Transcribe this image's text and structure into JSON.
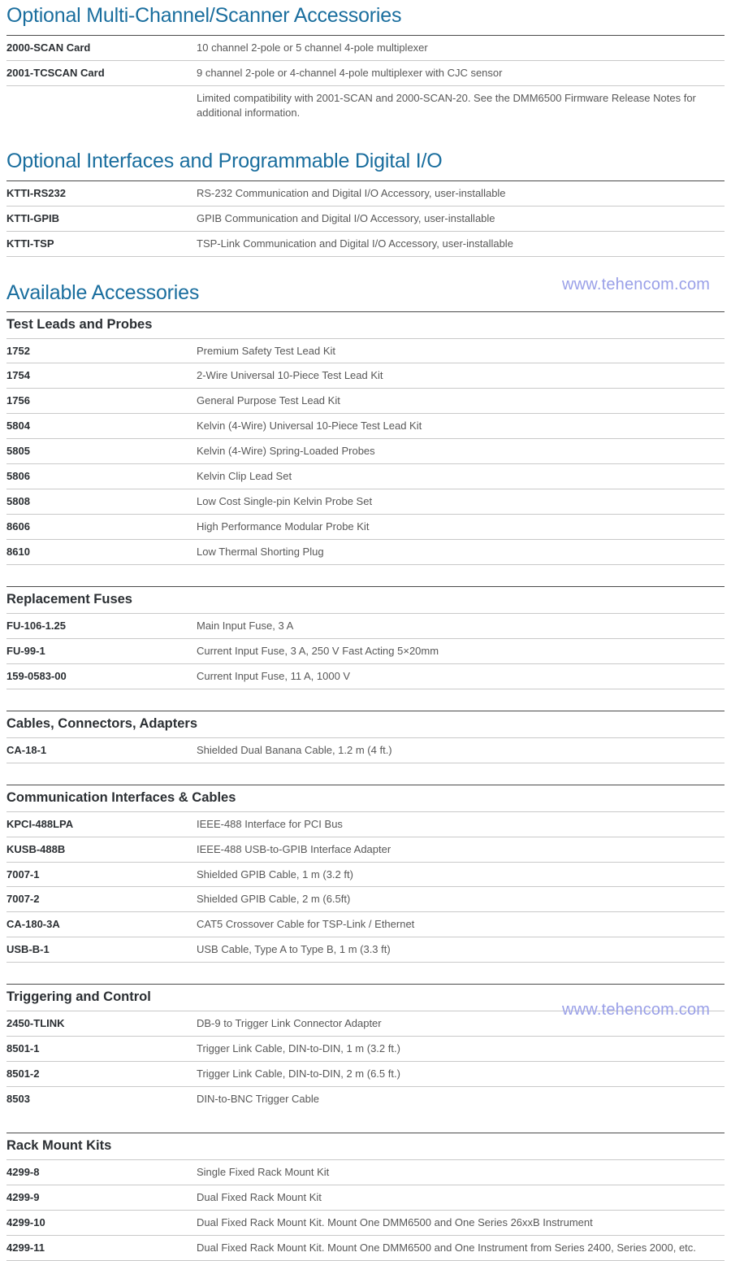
{
  "watermarks": [
    {
      "text": "www.tehencom.com"
    },
    {
      "text": "www.tehencom.com"
    }
  ],
  "colors": {
    "heading_blue": "#1a6e9e",
    "subhead_dark": "#2b2f33",
    "description_gray": "#585858",
    "rule_dark": "#4a4a4a",
    "rule_light": "#c9c9c9",
    "watermark": "#9aa0e8"
  },
  "sections": [
    {
      "title": "Optional Multi-Channel/Scanner Accessories",
      "rows": [
        {
          "part_number": "2000-SCAN Card",
          "description": "10 channel 2-pole or 5 channel 4-pole multiplexer"
        },
        {
          "part_number": "2001-TCSCAN Card",
          "description": "9 channel 2-pole or 4-channel 4-pole multiplexer with CJC sensor"
        },
        {
          "part_number": "",
          "description": "Limited compatibility with 2001-SCAN and 2000-SCAN-20. See the DMM6500 Firmware Release Notes for additional information."
        }
      ]
    },
    {
      "title": "Optional Interfaces and Programmable Digital I/O",
      "rows": [
        {
          "part_number": "KTTI-RS232",
          "description": "RS-232 Communication and Digital I/O Accessory, user-installable"
        },
        {
          "part_number": "KTTI-GPIB",
          "description": "GPIB Communication and Digital I/O Accessory, user-installable"
        },
        {
          "part_number": "KTTI-TSP",
          "description": "TSP-Link Communication and Digital I/O Accessory, user-installable"
        }
      ]
    }
  ],
  "available_accessories": {
    "title": "Available Accessories",
    "groups": [
      {
        "name": "Test Leads and Probes",
        "rows": [
          {
            "part_number": "1752",
            "description": "Premium Safety Test Lead Kit"
          },
          {
            "part_number": "1754",
            "description": "2-Wire Universal 10-Piece Test Lead Kit"
          },
          {
            "part_number": "1756",
            "description": "General Purpose Test Lead Kit"
          },
          {
            "part_number": "5804",
            "description": "Kelvin (4-Wire) Universal 10-Piece Test Lead Kit"
          },
          {
            "part_number": "5805",
            "description": "Kelvin (4-Wire) Spring-Loaded Probes"
          },
          {
            "part_number": "5806",
            "description": "Kelvin Clip Lead Set"
          },
          {
            "part_number": "5808",
            "description": "Low Cost Single-pin Kelvin Probe Set"
          },
          {
            "part_number": "8606",
            "description": "High Performance Modular Probe Kit"
          },
          {
            "part_number": "8610",
            "description": "Low Thermal Shorting Plug"
          }
        ]
      },
      {
        "name": "Replacement Fuses",
        "rows": [
          {
            "part_number": "FU-106-1.25",
            "description": "Main Input Fuse, 3 A"
          },
          {
            "part_number": "FU-99-1",
            "description": "Current Input Fuse, 3 A, 250 V Fast Acting 5×20mm"
          },
          {
            "part_number": "159-0583-00",
            "description": "Current Input Fuse, 11 A, 1000 V"
          }
        ]
      },
      {
        "name": "Cables, Connectors, Adapters",
        "rows": [
          {
            "part_number": "CA-18-1",
            "description": "Shielded Dual Banana Cable, 1.2 m (4 ft.)"
          }
        ]
      },
      {
        "name": "Communication Interfaces & Cables",
        "rows": [
          {
            "part_number": "KPCI-488LPA",
            "description": "IEEE-488 Interface for PCI Bus"
          },
          {
            "part_number": "KUSB-488B",
            "description": "IEEE-488 USB-to-GPIB Interface Adapter"
          },
          {
            "part_number": "7007-1",
            "description": "Shielded GPIB Cable, 1 m (3.2 ft)"
          },
          {
            "part_number": "7007-2",
            "description": "Shielded GPIB Cable, 2 m (6.5ft)"
          },
          {
            "part_number": "CA-180-3A",
            "description": "CAT5 Crossover Cable for TSP-Link / Ethernet"
          },
          {
            "part_number": "USB-B-1",
            "description": "USB Cable, Type A to Type B, 1 m (3.3 ft)"
          }
        ]
      },
      {
        "name": "Triggering and Control",
        "rows": [
          {
            "part_number": "2450-TLINK",
            "description": "DB-9 to Trigger Link Connector Adapter"
          },
          {
            "part_number": "8501-1",
            "description": "Trigger Link Cable, DIN-to-DIN, 1 m (3.2 ft.)"
          },
          {
            "part_number": "8501-2",
            "description": "Trigger Link Cable, DIN-to-DIN, 2 m (6.5 ft.)"
          },
          {
            "part_number": "8503",
            "description": "DIN-to-BNC Trigger Cable"
          }
        ]
      },
      {
        "name": "Rack Mount Kits",
        "rows": [
          {
            "part_number": "4299-8",
            "description": "Single Fixed Rack Mount Kit"
          },
          {
            "part_number": "4299-9",
            "description": "Dual Fixed Rack Mount Kit"
          },
          {
            "part_number": "4299-10",
            "description": "Dual Fixed Rack Mount Kit. Mount One DMM6500 and One Series 26xxB Instrument"
          },
          {
            "part_number": "4299-11",
            "description": "Dual Fixed Rack Mount Kit. Mount One DMM6500 and One Instrument from Series 2400, Series 2000, etc."
          }
        ]
      }
    ]
  }
}
